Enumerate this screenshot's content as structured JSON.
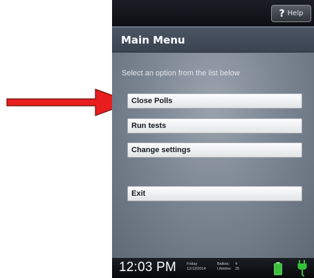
{
  "header": {
    "help_label": "Help",
    "help_icon": "?"
  },
  "title": "Main Menu",
  "instruction": "Select an option from the list below",
  "menu": [
    {
      "label": "Close Polls"
    },
    {
      "label": "Run tests"
    },
    {
      "label": "Change settings"
    },
    {
      "label": "Exit"
    }
  ],
  "status": {
    "time": "12:03 PM",
    "day": "Friday",
    "date": "12/12/2014",
    "ballots_label": "Ballots:",
    "ballots_value": "4",
    "lifetime_label": "Lifetime:",
    "lifetime_value": "25",
    "battery_icon": "battery-icon",
    "power_icon": "power-plug-icon"
  },
  "colors": {
    "arrow": "#e81e1e",
    "battery": "#3bbf3b",
    "plug": "#35c23a"
  }
}
